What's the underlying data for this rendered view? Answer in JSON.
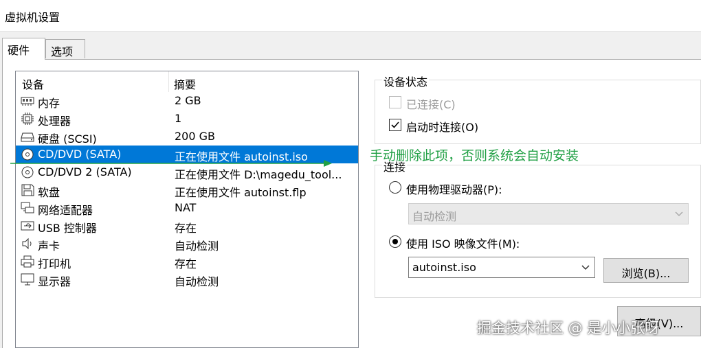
{
  "window": {
    "title": "虚拟机设置"
  },
  "tabs": [
    {
      "label": "硬件",
      "active": true
    },
    {
      "label": "选项",
      "active": false
    }
  ],
  "device_list": {
    "columns": [
      "设备",
      "摘要"
    ],
    "rows": [
      {
        "icon": "memory-icon",
        "name": "内存",
        "summary": "2 GB"
      },
      {
        "icon": "cpu-icon",
        "name": "处理器",
        "summary": "1"
      },
      {
        "icon": "hard-disk-icon",
        "name": "硬盘 (SCSI)",
        "summary": "200 GB"
      },
      {
        "icon": "cd-dvd-icon",
        "name": "CD/DVD (SATA)",
        "summary": "正在使用文件 autoinst.iso",
        "selected": true
      },
      {
        "icon": "cd-dvd-icon",
        "name": "CD/DVD 2 (SATA)",
        "summary": "正在使用文件 D:\\magedu_tool..."
      },
      {
        "icon": "floppy-icon",
        "name": "软盘",
        "summary": "正在使用文件 autoinst.flp"
      },
      {
        "icon": "network-adapter-icon",
        "name": "网络适配器",
        "summary": "NAT"
      },
      {
        "icon": "usb-icon",
        "name": "USB 控制器",
        "summary": "存在"
      },
      {
        "icon": "sound-icon",
        "name": "声卡",
        "summary": "自动检测"
      },
      {
        "icon": "printer-icon",
        "name": "打印机",
        "summary": "存在"
      },
      {
        "icon": "monitor-icon",
        "name": "显示器",
        "summary": "自动检测"
      }
    ]
  },
  "device_status": {
    "title": "设备状态",
    "connected_label": "已连接(C)",
    "connected": false,
    "connect_at_power_on_label": "启动时连接(O)",
    "connect_at_power_on": true
  },
  "connection": {
    "title": "连接",
    "physical_drive_label": "使用物理驱动器(P):",
    "physical_drive_value": "自动检测",
    "iso_label": "使用 ISO 映像文件(M):",
    "iso_value": "autoinst.iso",
    "browse_label": "浏览(B)...",
    "selected": "iso"
  },
  "advanced_button_label": "高级(V)...",
  "annotation": {
    "text": "手动删除此项，否则系统会自动安装",
    "color": "#21a045"
  },
  "watermark": "掘金技术社区 @ 是小小张呀",
  "colors": {
    "selection": "#0078d7"
  }
}
